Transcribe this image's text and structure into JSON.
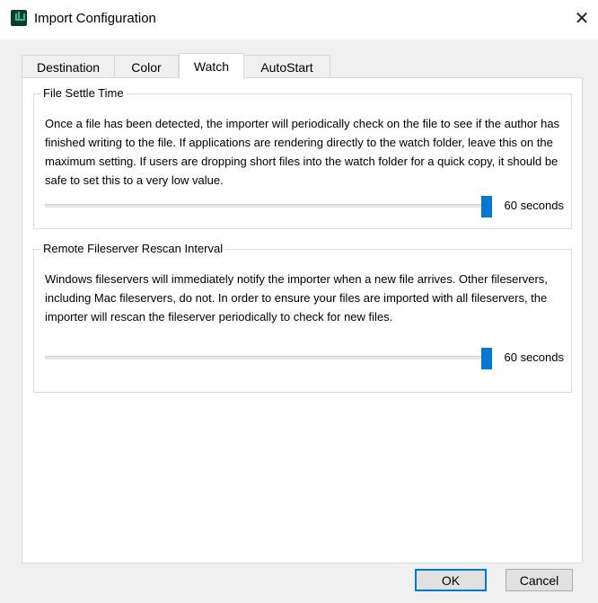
{
  "window": {
    "title": "Import Configuration",
    "close_glyph": "✕",
    "icon": "app-logo-icon"
  },
  "tabs": [
    {
      "label": "Destination",
      "selected": false
    },
    {
      "label": "Color",
      "selected": false
    },
    {
      "label": "Watch",
      "selected": true
    },
    {
      "label": "AutoStart",
      "selected": false
    }
  ],
  "file_settle": {
    "legend": "File Settle Time",
    "description": "Once a file has been detected, the importer will periodically check on the file to see if the author has finished writing to the file. If applications are rendering directly to the watch folder, leave this on the maximum setting. If users are dropping short files into the watch folder for a quick copy, it should be safe to set this to a very low value.",
    "value_label": "60 seconds",
    "slider_fraction": 1.0
  },
  "rescan": {
    "legend": "Remote Fileserver Rescan Interval",
    "description": "Windows fileservers will immediately notify the importer when a new file arrives. Other fileservers, including Mac fileservers, do not. In order to ensure your files are imported with all fileservers, the importer will rescan the fileserver periodically to check for new files.",
    "value_label": "60 seconds",
    "slider_fraction": 1.0
  },
  "buttons": {
    "ok": "OK",
    "cancel": "Cancel"
  },
  "colors": {
    "accent": "#0078d7",
    "window_bg": "#f0f0f0",
    "panel_bg": "#ffffff"
  }
}
